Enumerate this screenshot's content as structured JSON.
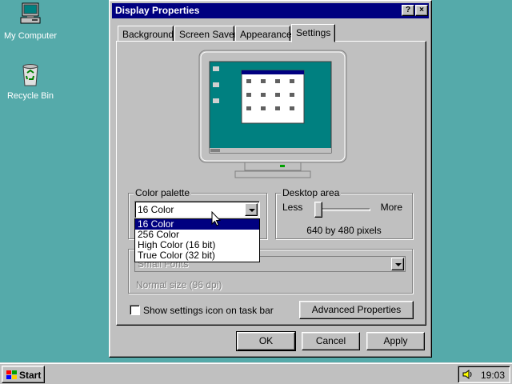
{
  "desktop": {
    "icons": [
      {
        "label": "My Computer",
        "icon": "my-computer-icon"
      },
      {
        "label": "Recycle Bin",
        "icon": "recycle-bin-icon"
      }
    ]
  },
  "dialog": {
    "title": "Display Properties",
    "help_button": "?",
    "close_button": "×",
    "tabs": [
      {
        "label": "Background"
      },
      {
        "label": "Screen Saver"
      },
      {
        "label": "Appearance"
      },
      {
        "label": "Settings",
        "active": true
      }
    ],
    "color_palette": {
      "title": "Color palette",
      "selected": "16 Color",
      "options": [
        "16 Color",
        "256 Color",
        "High Color (16 bit)",
        "True Color (32 bit)"
      ],
      "highlighted": "16 Color"
    },
    "desktop_area": {
      "title": "Desktop area",
      "less_label": "Less",
      "more_label": "More",
      "resolution": "640 by 480 pixels",
      "slider_level": 0
    },
    "font_size": {
      "selected": "Small Fonts",
      "note": "Normal size (96 dpi)"
    },
    "show_icon_checkbox": {
      "label": "Show settings icon on task bar",
      "checked": false
    },
    "advanced_button": "Advanced Properties",
    "ok_button": "OK",
    "cancel_button": "Cancel",
    "apply_button": "Apply"
  },
  "taskbar": {
    "start_label": "Start",
    "clock": "19:03"
  },
  "colors": {
    "desktop": "#55aaaa",
    "titlebar": "#000080",
    "face": "#c0c0c0"
  }
}
